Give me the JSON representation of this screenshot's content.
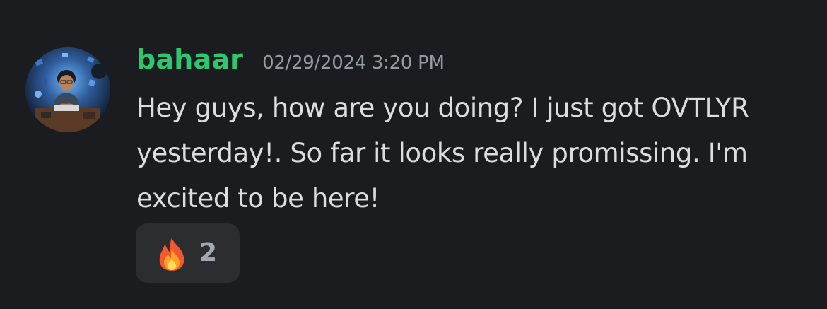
{
  "message": {
    "author": {
      "username": "bahaar",
      "name_color": "#2dc770",
      "avatar_icon": "avatar-icon"
    },
    "timestamp": "02/29/2024 3:20 PM",
    "lines": [
      "Hey guys, how are you doing? I just got OVTLYR",
      "yesterday!. So far it looks really promissing. I'm",
      "excited to be here!"
    ],
    "reactions": [
      {
        "emoji": "fire-icon",
        "count": "2"
      }
    ]
  },
  "colors": {
    "background": "#1b1c20",
    "text": "#dbdee1",
    "timestamp": "#949ba4",
    "reaction_bg": "#2b2d31"
  }
}
